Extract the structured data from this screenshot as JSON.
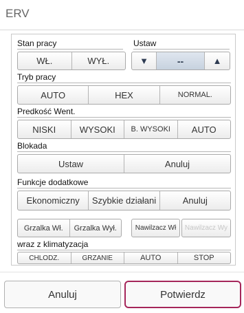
{
  "header": {
    "title": "ERV"
  },
  "status": {
    "label": "Stan pracy",
    "on": "WŁ.",
    "off": "WYŁ."
  },
  "setting": {
    "label": "Ustaw",
    "down": "▼",
    "value": "--",
    "up": "▲"
  },
  "mode": {
    "label": "Tryb pracy",
    "options": [
      "AUTO",
      "HEX",
      "NORMAL."
    ]
  },
  "fan": {
    "label": "Predkość Went.",
    "options": [
      "NISKI",
      "WYSOKI",
      "B. WYSOKI",
      "AUTO"
    ]
  },
  "lock": {
    "label": "Blokada",
    "set": "Ustaw",
    "cancel": "Anuluj"
  },
  "extra": {
    "label": "Funkcje dodatkowe",
    "options": [
      "Ekonomiczny",
      "Szybkie działani",
      "Anuluj"
    ]
  },
  "heater": {
    "on": "Grzalka Wł.",
    "off": "Grzalka Wył."
  },
  "humidifier": {
    "on": "Nawilzacz Wł",
    "off": "Nawilzacz Wy"
  },
  "ac": {
    "label": "wraz z klimatyzacja",
    "options": [
      "CHLODZ.",
      "GRZANIE",
      "AUTO",
      "STOP"
    ]
  },
  "footer": {
    "cancel": "Anuluj",
    "confirm": "Potwierdz"
  },
  "colors": {
    "confirm_border": "#a5265a",
    "stepper_value_bg": "#c7d2df"
  }
}
